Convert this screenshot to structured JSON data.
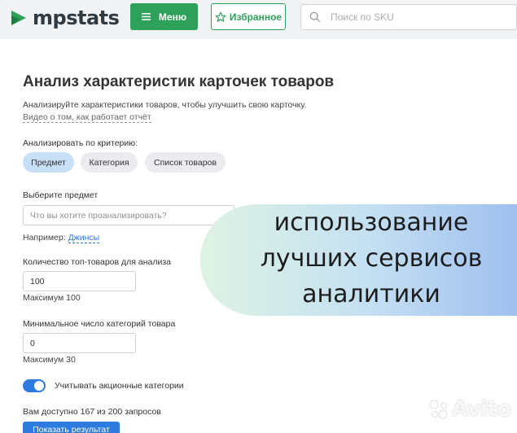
{
  "header": {
    "logo_text": "mpstats",
    "menu_label": "Меню",
    "favorites_label": "Избранное",
    "search_placeholder": "Поиск по SKU",
    "accent_color": "#2da05a"
  },
  "page": {
    "title": "Анализ характеристик карточек товаров",
    "description": "Анализируйте характеристики товаров, чтобы улучшить свою карточку.",
    "video_link": "Видео о том, как работает отчёт",
    "criteria_label": "Анализировать по критерию:",
    "criteria": [
      {
        "label": "Предмет",
        "active": true
      },
      {
        "label": "Категория",
        "active": false
      },
      {
        "label": "Список товаров",
        "active": false
      }
    ],
    "subject": {
      "label": "Выберите предмет",
      "placeholder": "Что вы хотите проанализировать?",
      "example_prefix": "Например:",
      "example_link": "Джинсы"
    },
    "top_count": {
      "label": "Количество топ-товаров для анализа",
      "value": "100",
      "max_hint": "Максимум 100"
    },
    "min_categories": {
      "label": "Минимальное число категорий товара",
      "value": "0",
      "max_hint": "Максимум 30"
    },
    "promo_toggle": {
      "label": "Учитывать акционные категории",
      "on": true
    },
    "quota_text": "Вам доступно 167 из 200 запросов",
    "analyze_button": "Показать результат",
    "link_color": "#2d7be0"
  },
  "overlay": {
    "lines": [
      "использование",
      "лучших сервисов",
      "аналитики"
    ]
  },
  "watermark": {
    "text": "Avito"
  }
}
